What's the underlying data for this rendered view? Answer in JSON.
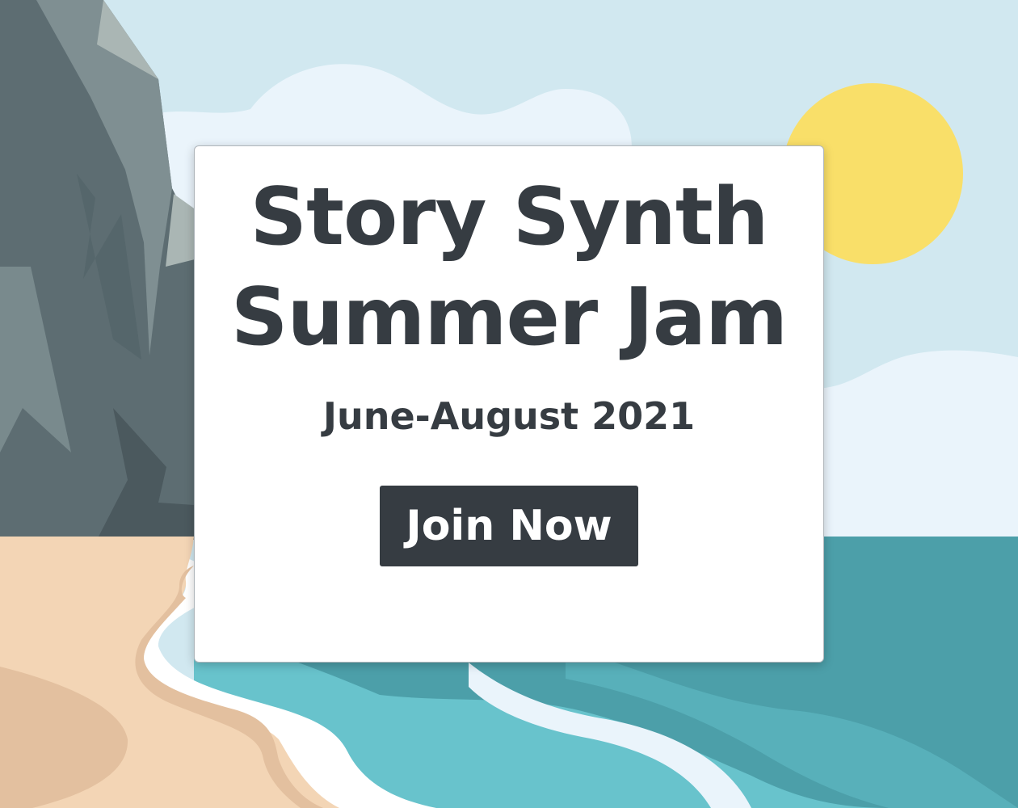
{
  "banner": {
    "title_line1": "Story Synth",
    "title_line2": "Summer Jam",
    "date_range": "June-August 2021",
    "join_button_label": "Join Now"
  },
  "colors": {
    "sky": "#d1e8f0",
    "cloud": "#eaf4fb",
    "sun": "#f9df69",
    "cliff_dark": "#5d6d72",
    "cliff_light": "#7f8f92",
    "sand": "#f3d5b5",
    "sea_deep": "#4c9fa9",
    "sea_shallow": "#68c3cc",
    "foam": "#ffffff",
    "text": "#363c42",
    "button_bg": "#363c42",
    "button_text": "#ffffff"
  }
}
